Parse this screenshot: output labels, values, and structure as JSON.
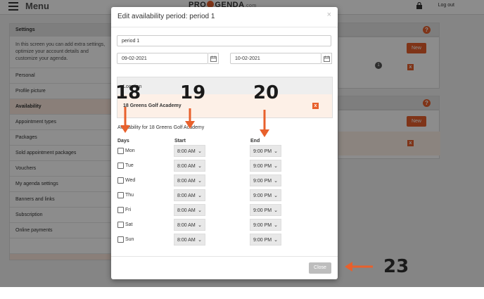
{
  "topbar": {
    "menu_label": "Menu",
    "logo_left": "PRO",
    "logo_right": "GENDA",
    "logo_suffix": ".com",
    "logout_label": "Log out"
  },
  "sidebar": {
    "header": "Settings",
    "description": "In this screen you can add extra settings, optimize your account details and customize your agenda.",
    "items": [
      "Personal",
      "Profile picture",
      "Availability",
      "Appointment types",
      "Packages",
      "Sold appointment packages",
      "Vouchers",
      "My agenda settings",
      "Banners and links",
      "Subscription",
      "Online payments"
    ]
  },
  "right_panel": {
    "help1": "?",
    "help2": "?",
    "new1": "New",
    "new2": "New",
    "count": "1",
    "x1": "x",
    "x2": "x"
  },
  "modal": {
    "title": "Edit availability period: period 1",
    "close_icon": "×",
    "name_value": "period 1",
    "start_date": "09-02-2021",
    "end_date": "10-02-2021",
    "location_header": "Location",
    "location_name": "18 Greens Golf Academy",
    "location_remove": "x",
    "availability_title": "Availability for 18 Greens Golf Academy",
    "col_days": "Days",
    "col_start": "Start",
    "col_end": "End",
    "rows": [
      {
        "day": "Mon",
        "start": "8:00 AM",
        "end": "9:00 PM"
      },
      {
        "day": "Tue",
        "start": "8:00 AM",
        "end": "9:00 PM"
      },
      {
        "day": "Wed",
        "start": "8:00 AM",
        "end": "9:00 PM"
      },
      {
        "day": "Thu",
        "start": "8:00 AM",
        "end": "9:00 PM"
      },
      {
        "day": "Fri",
        "start": "8:00 AM",
        "end": "9:00 PM"
      },
      {
        "day": "Sat",
        "start": "8:00 AM",
        "end": "9:00 PM"
      },
      {
        "day": "Sun",
        "start": "8:00 AM",
        "end": "9:00 PM"
      }
    ],
    "close_button": "Close"
  },
  "annotations": {
    "n18": "18",
    "n19": "19",
    "n20": "20",
    "n23": "23"
  },
  "colors": {
    "accent": "#e8602c",
    "overlay": "rgba(0,0,0,0.45)"
  },
  "icons": [
    "menu-icon",
    "lock-icon",
    "calendar-icon",
    "chevron-down-icon",
    "close-icon",
    "help-icon",
    "arrow-icon"
  ]
}
